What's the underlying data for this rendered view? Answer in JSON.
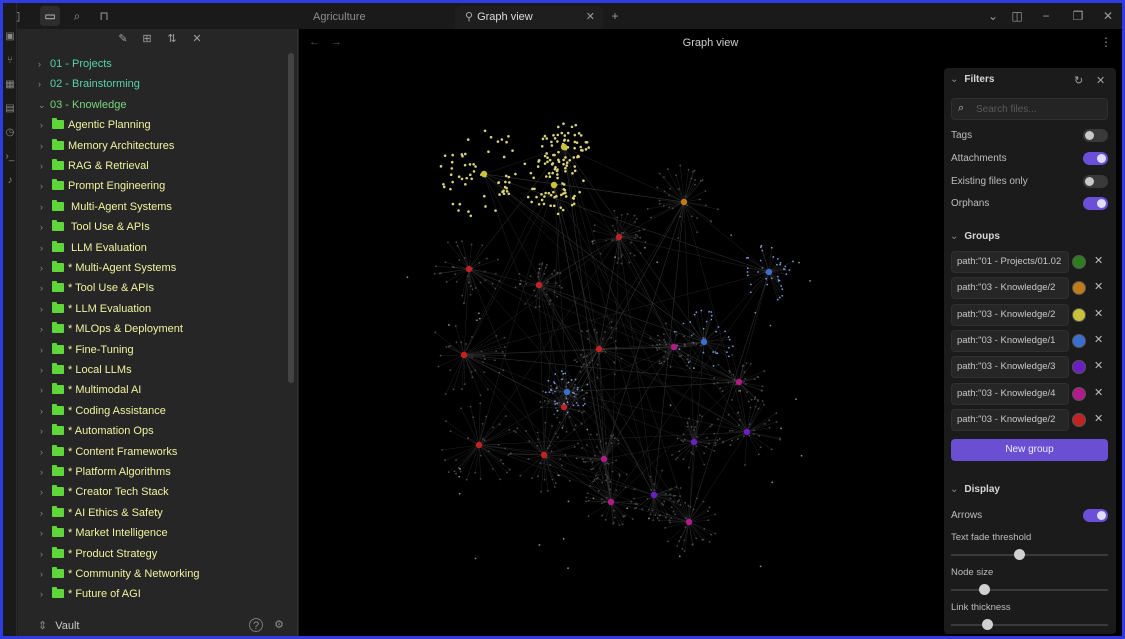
{
  "window": {
    "tabs": [
      {
        "label": "Agriculture"
      },
      {
        "label": "Graph view"
      }
    ],
    "new_tab": "+",
    "controls": {
      "minimize": "−",
      "restore": "❐",
      "close": "✕"
    }
  },
  "sidebar": {
    "tree": [
      {
        "label": "01 - Projects",
        "level": "top"
      },
      {
        "label": "02 - Brainstorming",
        "level": "top"
      },
      {
        "label": "03 - Knowledge",
        "level": "know"
      },
      {
        "label": "Agentic Planning",
        "level": "sub"
      },
      {
        "label": "Memory Architectures",
        "level": "sub"
      },
      {
        "label": "RAG & Retrieval",
        "level": "sub"
      },
      {
        "label": "Prompt Engineering",
        "level": "sub"
      },
      {
        "label": " Multi-Agent Systems",
        "level": "sub"
      },
      {
        "label": " Tool Use & APIs",
        "level": "sub"
      },
      {
        "label": " LLM Evaluation",
        "level": "sub"
      },
      {
        "label": "* Multi-Agent Systems",
        "level": "sub"
      },
      {
        "label": "* Tool Use & APIs",
        "level": "sub"
      },
      {
        "label": "* LLM Evaluation",
        "level": "sub"
      },
      {
        "label": "* MLOps & Deployment",
        "level": "sub"
      },
      {
        "label": "* Fine-Tuning",
        "level": "sub"
      },
      {
        "label": "* Local LLMs",
        "level": "sub"
      },
      {
        "label": "* Multimodal AI",
        "level": "sub"
      },
      {
        "label": "* Coding Assistance",
        "level": "sub"
      },
      {
        "label": "* Automation Ops",
        "level": "sub"
      },
      {
        "label": "* Content Frameworks",
        "level": "sub"
      },
      {
        "label": "* Platform Algorithms",
        "level": "sub"
      },
      {
        "label": "* Creator Tech Stack",
        "level": "sub"
      },
      {
        "label": "* AI Ethics & Safety",
        "level": "sub"
      },
      {
        "label": "* Market Intelligence",
        "level": "sub"
      },
      {
        "label": "* Product Strategy",
        "level": "sub"
      },
      {
        "label": "* Community & Networking",
        "level": "sub"
      },
      {
        "label": "* Future of AGI",
        "level": "sub"
      }
    ],
    "vault_label": "Vault"
  },
  "main": {
    "title": "Graph view"
  },
  "filters": {
    "title": "Filters",
    "search_placeholder": "Search files...",
    "options": [
      {
        "label": "Tags",
        "on": false
      },
      {
        "label": "Attachments",
        "on": true
      },
      {
        "label": "Existing files only",
        "on": false
      },
      {
        "label": "Orphans",
        "on": true
      }
    ],
    "groups_title": "Groups",
    "groups": [
      {
        "query": "path:\"01 - Projects/01.02",
        "color": "#2e7d1e"
      },
      {
        "query": "path:\"03 - Knowledge/2",
        "color": "#c47a1a"
      },
      {
        "query": "path:\"03 - Knowledge/2",
        "color": "#c9c23a"
      },
      {
        "query": "path:\"03 - Knowledge/1",
        "color": "#3a6fd0"
      },
      {
        "query": "path:\"03 - Knowledge/3",
        "color": "#6a1fc4"
      },
      {
        "query": "path:\"03 - Knowledge/4",
        "color": "#b21a8a"
      },
      {
        "query": "path:\"03 - Knowledge/2",
        "color": "#c42222"
      }
    ],
    "new_group_label": "New group",
    "display_title": "Display",
    "arrows_label": "Arrows",
    "arrows_on": true,
    "sliders": [
      {
        "label": "Text fade threshold",
        "value": 0.43
      },
      {
        "label": "Node size",
        "value": 0.19
      },
      {
        "label": "Link thickness",
        "value": 0.21
      }
    ]
  }
}
